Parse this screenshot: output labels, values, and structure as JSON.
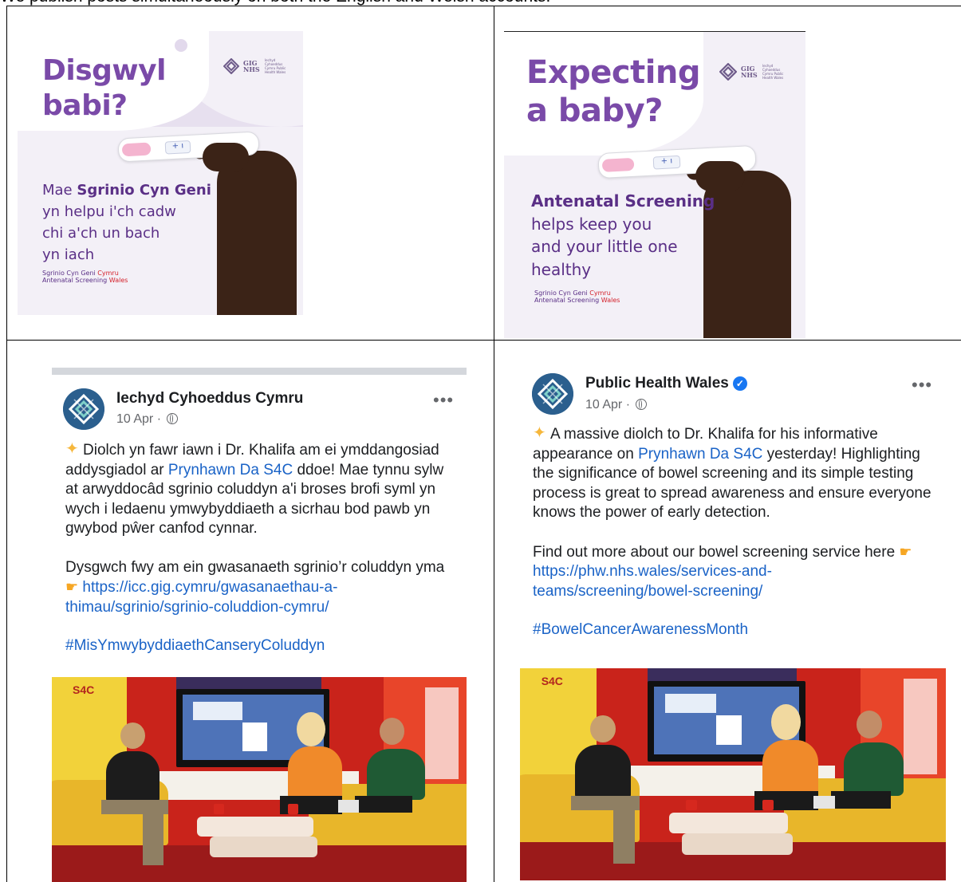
{
  "intro_text": "We publish posts simultaneously on both the English and Welsh accounts:",
  "welsh_graphic": {
    "headline_1": "Disgwyl",
    "headline_2": "babi?",
    "body_1_pre": "Mae ",
    "body_1_bold": "Sgrinio Cyn Geni",
    "body_2": "yn helpu i'ch cadw",
    "body_3": "chi a'ch un bach",
    "body_4": "yn iach",
    "brand_1": "Sgrinio Cyn Geni ",
    "brand_1_red": "Cymru",
    "brand_2": "Antenatal Screening ",
    "brand_2_red": "Wales",
    "logo_main": "GIG NHS",
    "logo_small": "Iechyd Cyhoeddus Cymru Public Health Wales"
  },
  "english_graphic": {
    "headline_1": "Expecting",
    "headline_2": "a baby?",
    "body_1_bold": "Antenatal Screening",
    "body_2": "helps keep you",
    "body_3": "and your little one",
    "body_4": "healthy",
    "brand_1": "Sgrinio Cyn Geni ",
    "brand_1_red": "Cymru",
    "brand_2": "Antenatal Screening ",
    "brand_2_red": "Wales",
    "logo_main": "GIG NHS",
    "logo_small": "Iechyd Cyhoeddus Cymru Public Health Wales"
  },
  "welsh_post": {
    "name": "Iechyd Cyhoeddus Cymru",
    "meta": "10 Apr · ",
    "more": "•••",
    "p1_a": "Diolch yn fawr iawn i Dr. Khalifa am ei ymddangosiad addysgiadol ar ",
    "p1_link": "Prynhawn Da S4C",
    "p1_b": " ddoe! Mae tynnu sylw at arwyddocâd sgrinio coluddyn a'i broses brofi syml yn wych i ledaenu ymwybyddiaeth a sicrhau bod pawb yn gwybod pŵer canfod cynnar.",
    "p2_a": "Dysgwch fwy am ein gwasanaeth sgrinio’r coluddyn yma ",
    "p2_link": "https://icc.gig.cymru/gwasanaethau-a-thimau/sgrinio/sgrinio-coluddion-cymru/",
    "hashtag": "#MisYmwybyddiaethCanseryColuddyn"
  },
  "english_post": {
    "name": "Public Health Wales",
    "meta": "10 Apr · ",
    "more": "•••",
    "p1_a": "A massive diolch to Dr. Khalifa for his informative appearance on ",
    "p1_link": "Prynhawn Da S4C",
    "p1_b": " yesterday! Highlighting the significance of bowel screening and its simple testing process is great to spread awareness and ensure everyone knows the power of early detection.",
    "p2_a": "Find out more about our bowel screening service here ",
    "p2_link": "https://phw.nhs.wales/services-and-teams/screening/bowel-screening/",
    "hashtag": "#BowelCancerAwarenessMonth"
  },
  "photo": {
    "channel_logo": "S4C"
  },
  "colors": {
    "purple_text": "#7a4aa8",
    "lavender_bg": "#f3f0f7",
    "link_blue": "#1a63c7",
    "verified_blue": "#1877f2"
  }
}
